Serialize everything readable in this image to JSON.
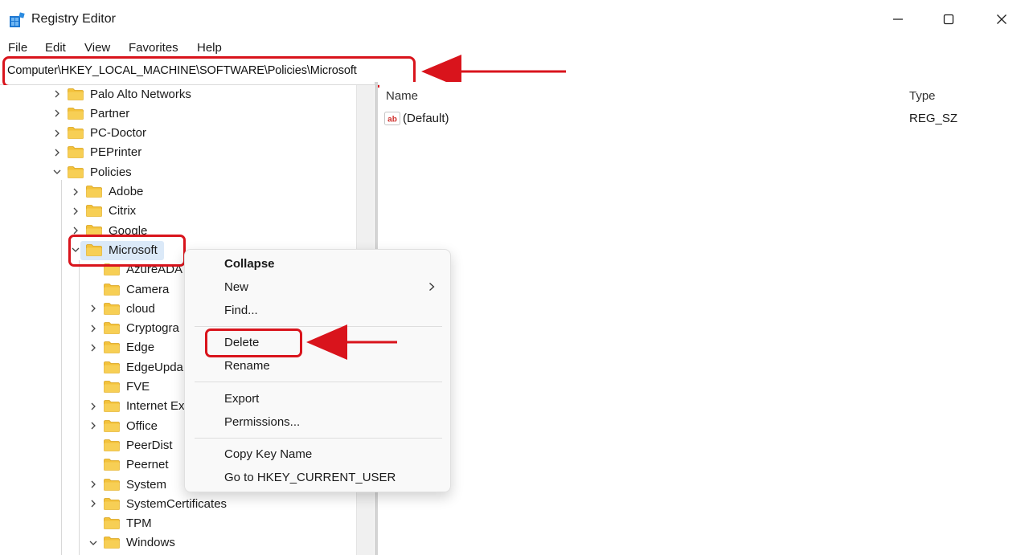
{
  "window": {
    "title": "Registry Editor",
    "icon": "registry-editor-icon",
    "controls": [
      "minimize-icon",
      "maximize-icon",
      "close-icon"
    ]
  },
  "menu": {
    "items": [
      "File",
      "Edit",
      "View",
      "Favorites",
      "Help"
    ]
  },
  "address": {
    "path": "Computer\\HKEY_LOCAL_MACHINE\\SOFTWARE\\Policies\\Microsoft"
  },
  "tree": {
    "items": [
      {
        "label": "Palo Alto Networks",
        "state": "collapsed"
      },
      {
        "label": "Partner",
        "state": "collapsed"
      },
      {
        "label": "PC-Doctor",
        "state": "collapsed"
      },
      {
        "label": "PEPrinter",
        "state": "collapsed"
      },
      {
        "label": "Policies",
        "state": "expanded"
      },
      {
        "label": "Adobe",
        "state": "collapsed"
      },
      {
        "label": "Citrix",
        "state": "collapsed"
      },
      {
        "label": "Google",
        "state": "collapsed"
      },
      {
        "label": "Microsoft",
        "state": "expanded",
        "selected": true
      },
      {
        "label": "AzureADA",
        "state": "leaf"
      },
      {
        "label": "Camera",
        "state": "leaf"
      },
      {
        "label": "cloud",
        "state": "collapsed"
      },
      {
        "label": "Cryptogra",
        "state": "collapsed"
      },
      {
        "label": "Edge",
        "state": "collapsed"
      },
      {
        "label": "EdgeUpda",
        "state": "leaf"
      },
      {
        "label": "FVE",
        "state": "leaf"
      },
      {
        "label": "Internet Ex",
        "state": "collapsed"
      },
      {
        "label": "Office",
        "state": "collapsed"
      },
      {
        "label": "PeerDist",
        "state": "leaf"
      },
      {
        "label": "Peernet",
        "state": "leaf"
      },
      {
        "label": "System",
        "state": "collapsed"
      },
      {
        "label": "SystemCertificates",
        "state": "collapsed"
      },
      {
        "label": "TPM",
        "state": "leaf"
      },
      {
        "label": "Windows",
        "state": "expanded"
      }
    ]
  },
  "values_pane": {
    "columns": {
      "name": "Name",
      "type": "Type"
    },
    "rows": [
      {
        "name": "(Default)",
        "type": "REG_SZ",
        "icon": "string-value-icon"
      }
    ]
  },
  "context_menu": {
    "items": [
      {
        "label": "Collapse",
        "bold": true
      },
      {
        "label": "New",
        "submenu": true
      },
      {
        "label": "Find..."
      },
      {
        "label": "Delete",
        "highlighted": true
      },
      {
        "label": "Rename"
      },
      {
        "label": "Export"
      },
      {
        "label": "Permissions..."
      },
      {
        "label": "Copy Key Name"
      },
      {
        "label": "Go to HKEY_CURRENT_USER"
      }
    ]
  },
  "colors": {
    "annotation": "#d9141c",
    "folder": "#f3c23a",
    "selection": "#dbe9f8"
  }
}
